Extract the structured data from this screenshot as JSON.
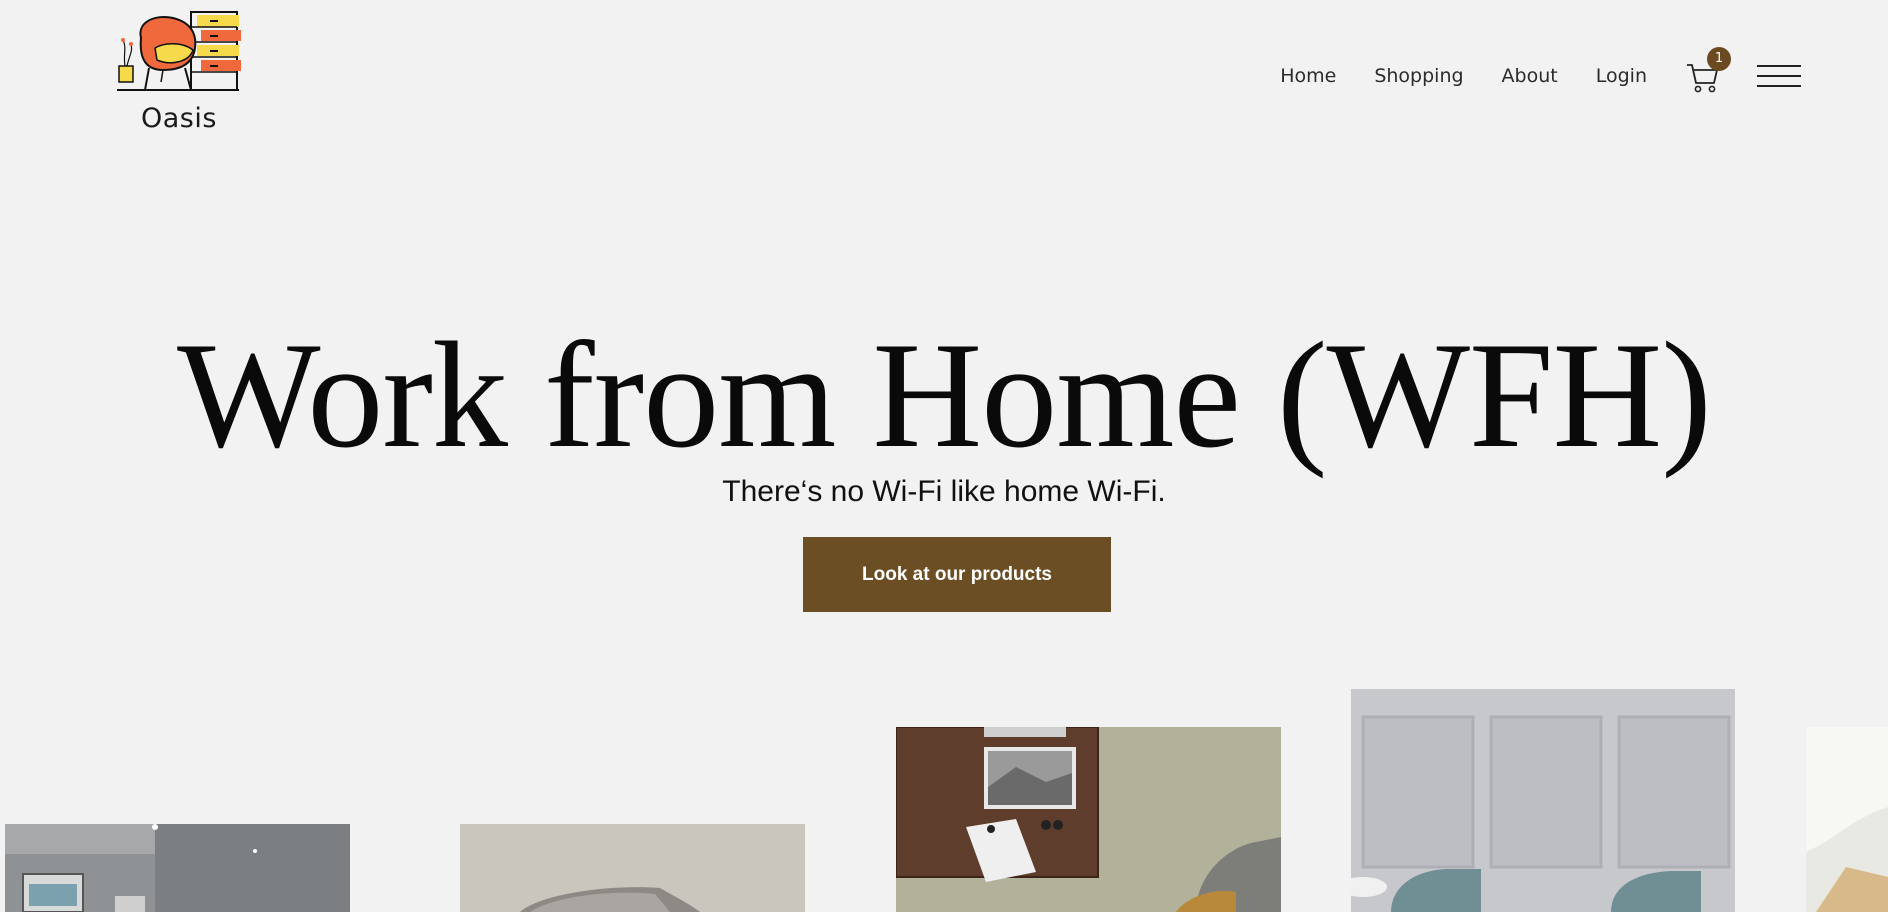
{
  "header": {
    "brand_name": "Oasis",
    "nav": [
      {
        "label": "Home"
      },
      {
        "label": "Shopping"
      },
      {
        "label": "About"
      },
      {
        "label": "Login"
      }
    ],
    "cart_count": "1",
    "cart_icon": "shopping-cart-icon",
    "menu_icon": "hamburger-menu-icon"
  },
  "hero": {
    "title": "Work from Home (WFH)",
    "subtitle": "There‘s no Wi-Fi like home Wi-Fi.",
    "cta_label": "Look at our products"
  },
  "colors": {
    "background": "#f2f2f3",
    "accent_brown": "#6b4e24",
    "logo_orange": "#f0693c",
    "logo_yellow": "#f7d94c"
  }
}
